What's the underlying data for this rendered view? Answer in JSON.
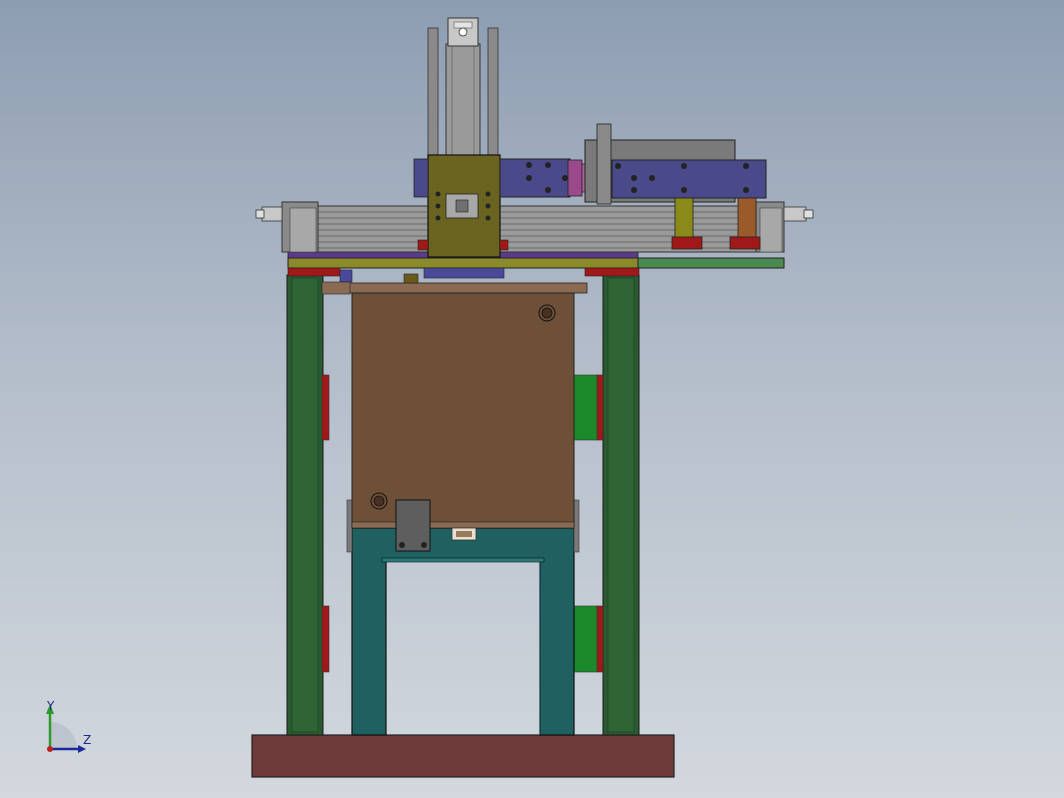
{
  "viewport": {
    "background_top": "#8d9db1",
    "background_bottom": "#d3d8de"
  },
  "triad": {
    "y_label": "Y",
    "z_label": "Z",
    "y_color": "#2a9a2a",
    "z_color": "#1a2a9a",
    "origin_color": "#c02020"
  },
  "colors": {
    "frame_green": "#2a5a30",
    "base_plate": "#6e3a3a",
    "teal_stand": "#1f6060",
    "brown_block": "#6e5038",
    "olive_carriage": "#6b6420",
    "purple_rail": "#4a4a8a",
    "red_pad": "#9a1a1a",
    "magenta_coupler": "#9a4a8a",
    "gray_cylinder": "#8a8a8a",
    "light_green_plate": "#4a8a50"
  }
}
